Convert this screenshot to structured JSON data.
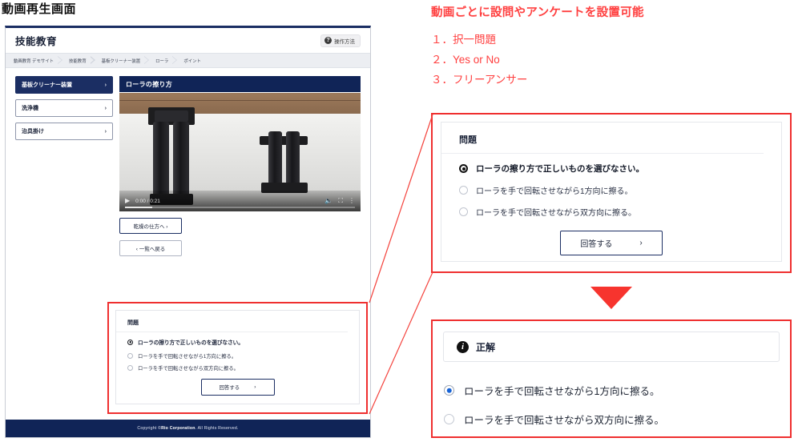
{
  "caption": "動画再生画面",
  "app": {
    "title": "技能教育",
    "help_button": {
      "label": "操作方法",
      "icon": "help-circle-icon"
    },
    "breadcrumb": [
      "動画教育 デモサイト",
      "技能教育",
      "基板クリーナー装置",
      "ローラ",
      "ポイント"
    ],
    "sidebar": {
      "items": [
        {
          "label": "基板クリーナー装置",
          "active": true,
          "chevron": "›"
        },
        {
          "label": "洗浄機",
          "active": false,
          "chevron": "›"
        },
        {
          "label": "治具掛け",
          "active": false,
          "chevron": "›"
        }
      ]
    },
    "video_panel": {
      "header": "ローラの擦り方",
      "player": {
        "time": "0:00 / 0:21",
        "play_icon": "play-icon",
        "volume_icon": "volume-icon",
        "fullscreen_icon": "fullscreen-icon",
        "more_icon": "more-vertical-icon",
        "progress_percent": 12
      }
    },
    "actions": {
      "next": "乾燥の仕方へ ›",
      "back": "‹ 一覧へ戻る"
    },
    "quiz": {
      "section_title": "問題",
      "prompt": "ローラの擦り方で正しいものを選びなさい。",
      "options": [
        "ローラを手で回転させながら1方向に擦る。",
        "ローラを手で回転させながら双方向に擦る。"
      ],
      "submit_label": "回答する",
      "submit_chevron": "›"
    },
    "footer": {
      "prefix": "Copyright © ",
      "company": "Rio Corporation",
      "suffix": ". All Rights Reserved."
    }
  },
  "annotation": {
    "heading": "動画ごとに設問やアンケートを設置可能",
    "items": [
      "１．択一問題",
      "２．Yes or No",
      "３．フリーアンサー"
    ],
    "color": "#ff4040"
  },
  "answer_panel": {
    "badge_icon": "info-icon",
    "title": "正解",
    "options": [
      {
        "label": "ローラを手で回転させながら1方向に擦る。",
        "selected": true
      },
      {
        "label": "ローラを手で回転させながら双方向に擦る。",
        "selected": false
      }
    ],
    "selected_color": "#1763d6"
  },
  "colors": {
    "navy": "#102457",
    "navy_dark": "#1b2e63",
    "red_annotation": "#ff4040",
    "red_box": "#ef2f2f",
    "red_arrow": "#f7342e"
  }
}
